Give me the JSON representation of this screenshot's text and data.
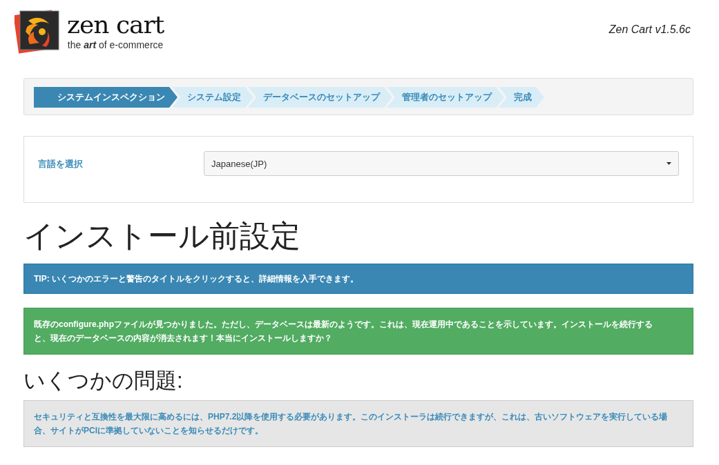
{
  "header": {
    "logo_title": "zen cart",
    "logo_tagline": "the **art** of e-commerce",
    "version": "Zen Cart v1.5.6c"
  },
  "steps": [
    {
      "label": "システムインスペクション",
      "selected": true
    },
    {
      "label": "システム設定",
      "selected": false
    },
    {
      "label": "データベースのセットアップ",
      "selected": false
    },
    {
      "label": "管理者のセットアップ",
      "selected": false
    },
    {
      "label": "完成",
      "selected": false
    }
  ],
  "language": {
    "label": "言語を選択",
    "value": "Japanese(JP)"
  },
  "title": "インストール前設定",
  "alerts": [
    {
      "kind": "info",
      "text": "TIP: いくつかのエラーと警告のタイトルをクリックすると、詳細情報を入手できます。"
    },
    {
      "kind": "success",
      "text": "既存のconfigure.phpファイルが見つかりました。ただし、データベースは最新のようです。これは、現在運用中であることを示しています。インストールを続行すると、現在のデータベースの内容が消去されます！本当にインストールしますか？"
    }
  ],
  "issues_heading": "いくつかの問題:",
  "issues": [
    {
      "kind": "warning",
      "text": "セキュリティと互換性を最大限に高めるには、PHP7.2以降を使用する必要があります。このインストーラは続行できますが、これは、古いソフトウェアを実行している場合、サイトがPCIに準拠していないことを知らせるだけです。"
    }
  ]
}
